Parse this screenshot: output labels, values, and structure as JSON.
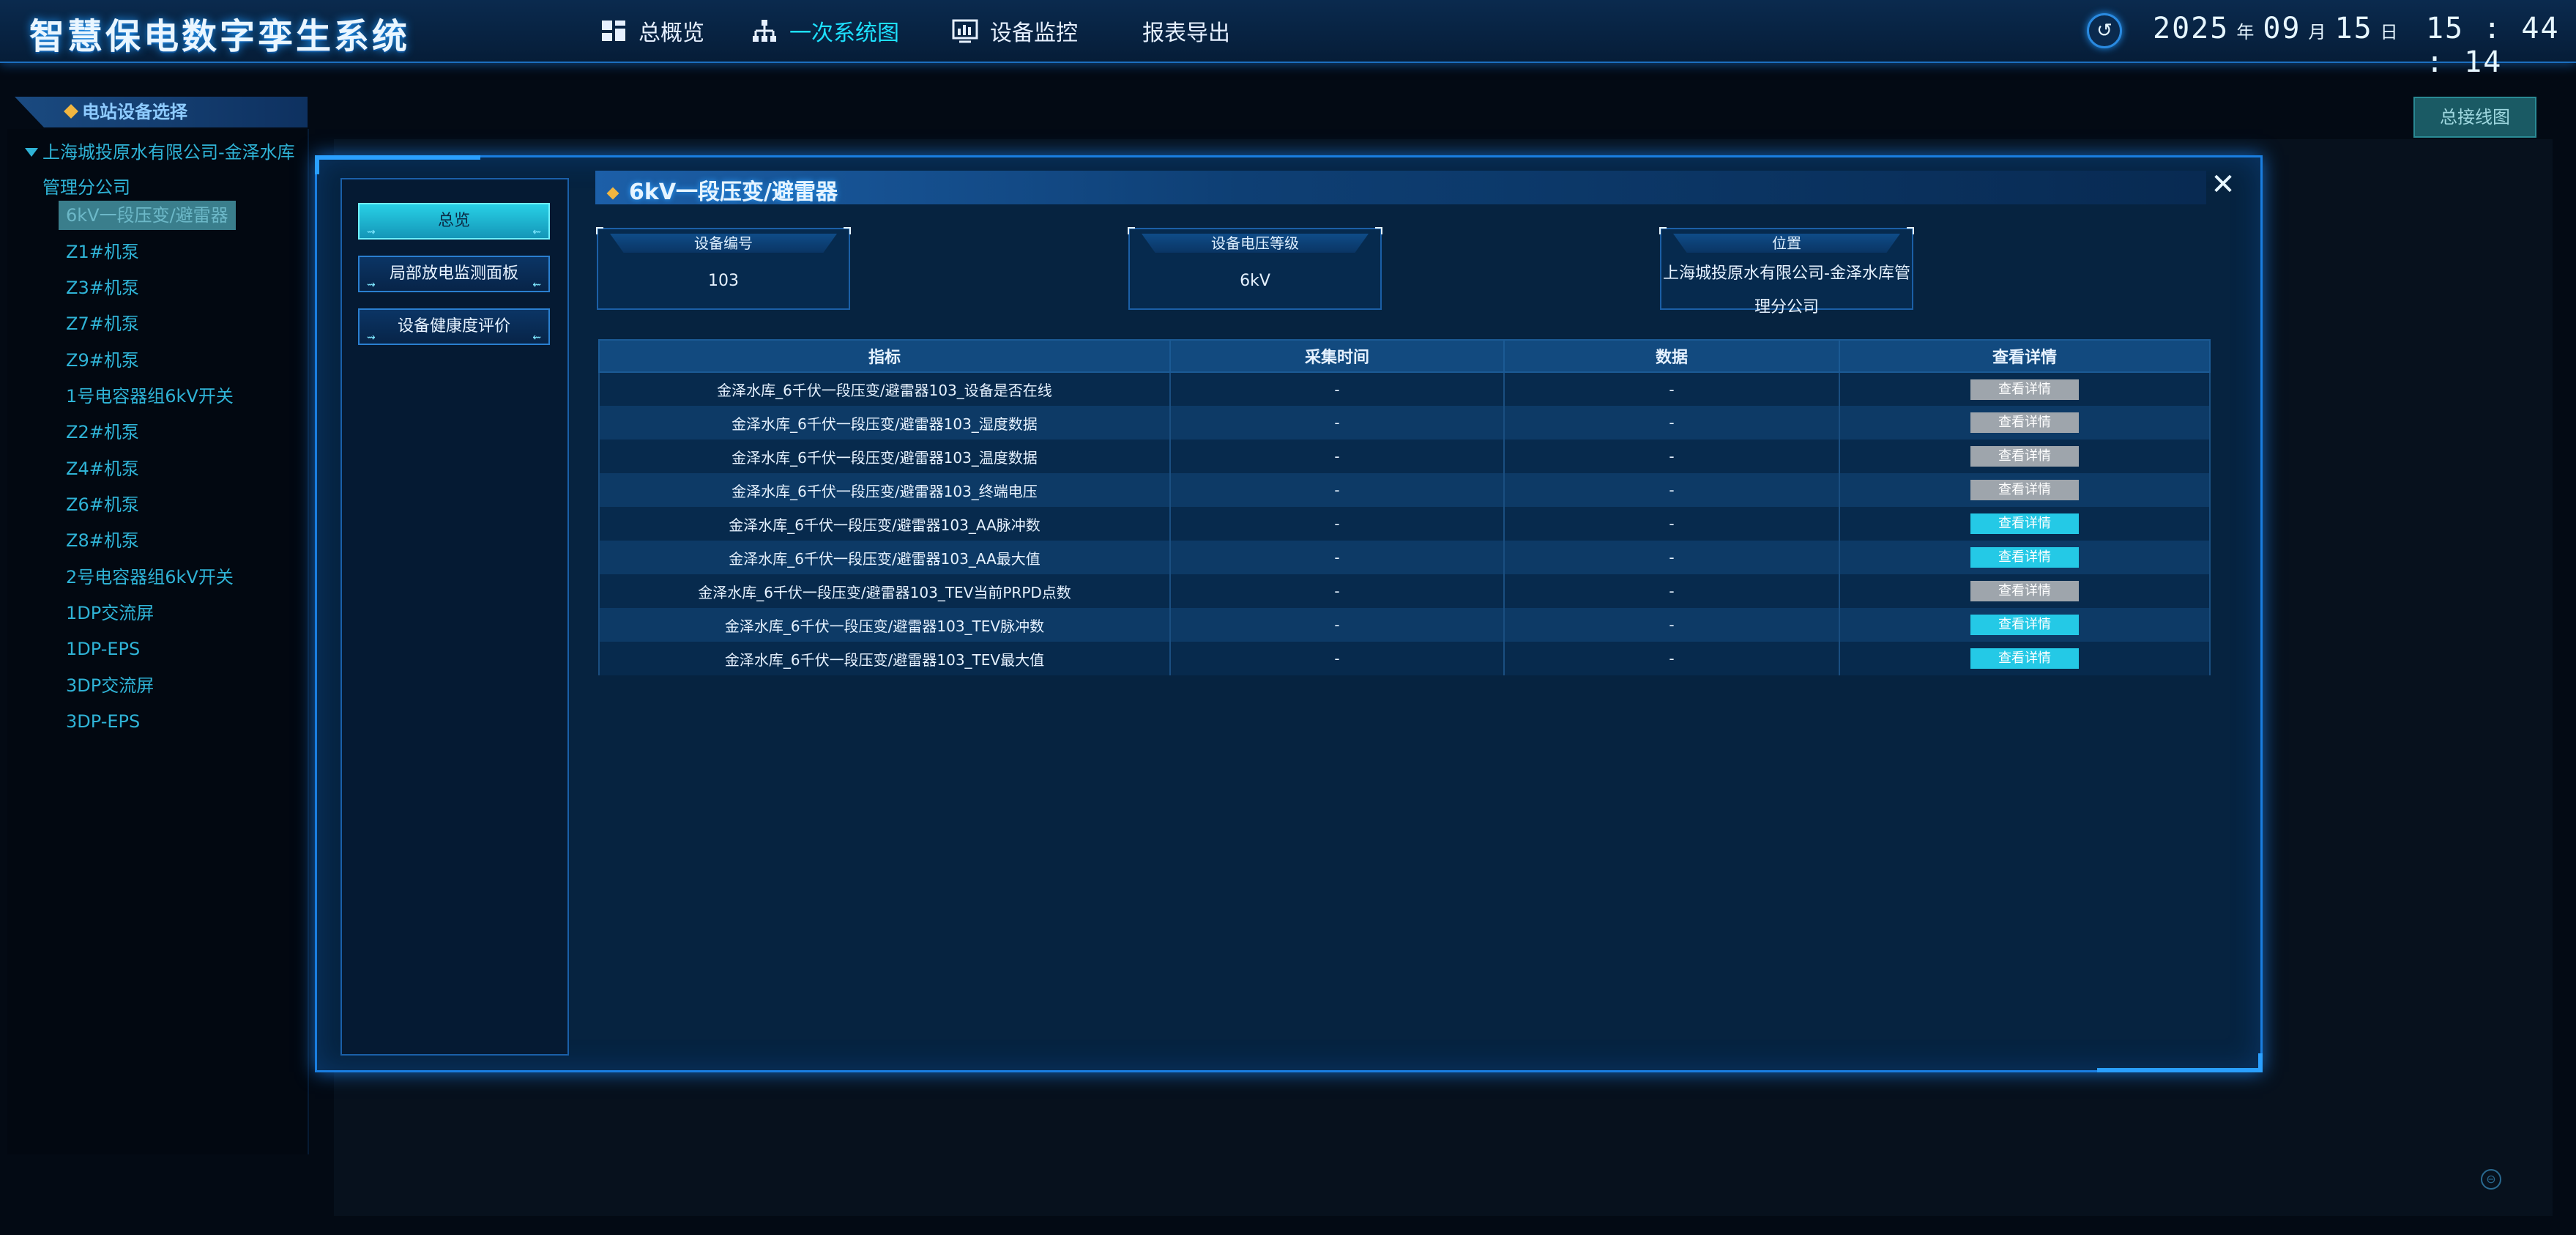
{
  "app": {
    "title": "智慧保电数字孪生系统"
  },
  "nav": [
    {
      "label": "总概览",
      "icon": "dashboard-icon",
      "active": false
    },
    {
      "label": "一次系统图",
      "icon": "hierarchy-icon",
      "active": true
    },
    {
      "label": "设备监控",
      "icon": "monitor-chart-icon",
      "active": false
    },
    {
      "label": "报表导出",
      "icon": "",
      "active": false
    }
  ],
  "datetime": {
    "year": "2025",
    "year_unit": "年",
    "month": "09",
    "month_unit": "月",
    "day": "15",
    "day_unit": "日",
    "time": "15 : 44 : 14"
  },
  "sidebar": {
    "header": "电站设备选择",
    "root": "上海城投原水有限公司-金泽水库管理分公司",
    "items": [
      "6kV一段压变/避雷器",
      "Z1#机泵",
      "Z3#机泵",
      "Z7#机泵",
      "Z9#机泵",
      "1号电容器组6kV开关",
      "Z2#机泵",
      "Z4#机泵",
      "Z6#机泵",
      "Z8#机泵",
      "2号电容器组6kV开关",
      "1DP交流屏",
      "1DP-EPS",
      "3DP交流屏",
      "3DP-EPS"
    ],
    "selected_index": 0
  },
  "overview_button": "总接线图",
  "modal": {
    "title": "6kV一段压变/避雷器",
    "left_tabs": [
      "总览",
      "局部放电监测面板",
      "设备健康度评价"
    ],
    "active_tab_index": 0,
    "cards": [
      {
        "label": "设备编号",
        "value": "103"
      },
      {
        "label": "设备电压等级",
        "value": "6kV"
      },
      {
        "label": "位置",
        "value": "上海城投原水有限公司-金泽水库管理分公司"
      }
    ],
    "table": {
      "headers": [
        "指标",
        "采集时间",
        "数据",
        "查看详情"
      ],
      "rows": [
        {
          "metric": "金泽水库_6千伏一段压变/避雷器103_设备是否在线",
          "time": "-",
          "data": "-",
          "detail": "查看详情",
          "enabled": false
        },
        {
          "metric": "金泽水库_6千伏一段压变/避雷器103_湿度数据",
          "time": "-",
          "data": "-",
          "detail": "查看详情",
          "enabled": false
        },
        {
          "metric": "金泽水库_6千伏一段压变/避雷器103_温度数据",
          "time": "-",
          "data": "-",
          "detail": "查看详情",
          "enabled": false
        },
        {
          "metric": "金泽水库_6千伏一段压变/避雷器103_终端电压",
          "time": "-",
          "data": "-",
          "detail": "查看详情",
          "enabled": false
        },
        {
          "metric": "金泽水库_6千伏一段压变/避雷器103_AA脉冲数",
          "time": "-",
          "data": "-",
          "detail": "查看详情",
          "enabled": true
        },
        {
          "metric": "金泽水库_6千伏一段压变/避雷器103_AA最大值",
          "time": "-",
          "data": "-",
          "detail": "查看详情",
          "enabled": true
        },
        {
          "metric": "金泽水库_6千伏一段压变/避雷器103_TEV当前PRPD点数",
          "time": "-",
          "data": "-",
          "detail": "查看详情",
          "enabled": false
        },
        {
          "metric": "金泽水库_6千伏一段压变/避雷器103_TEV脉冲数",
          "time": "-",
          "data": "-",
          "detail": "查看详情",
          "enabled": true
        },
        {
          "metric": "金泽水库_6千伏一段压变/避雷器103_TEV最大值",
          "time": "-",
          "data": "-",
          "detail": "查看详情",
          "enabled": true
        }
      ]
    }
  }
}
